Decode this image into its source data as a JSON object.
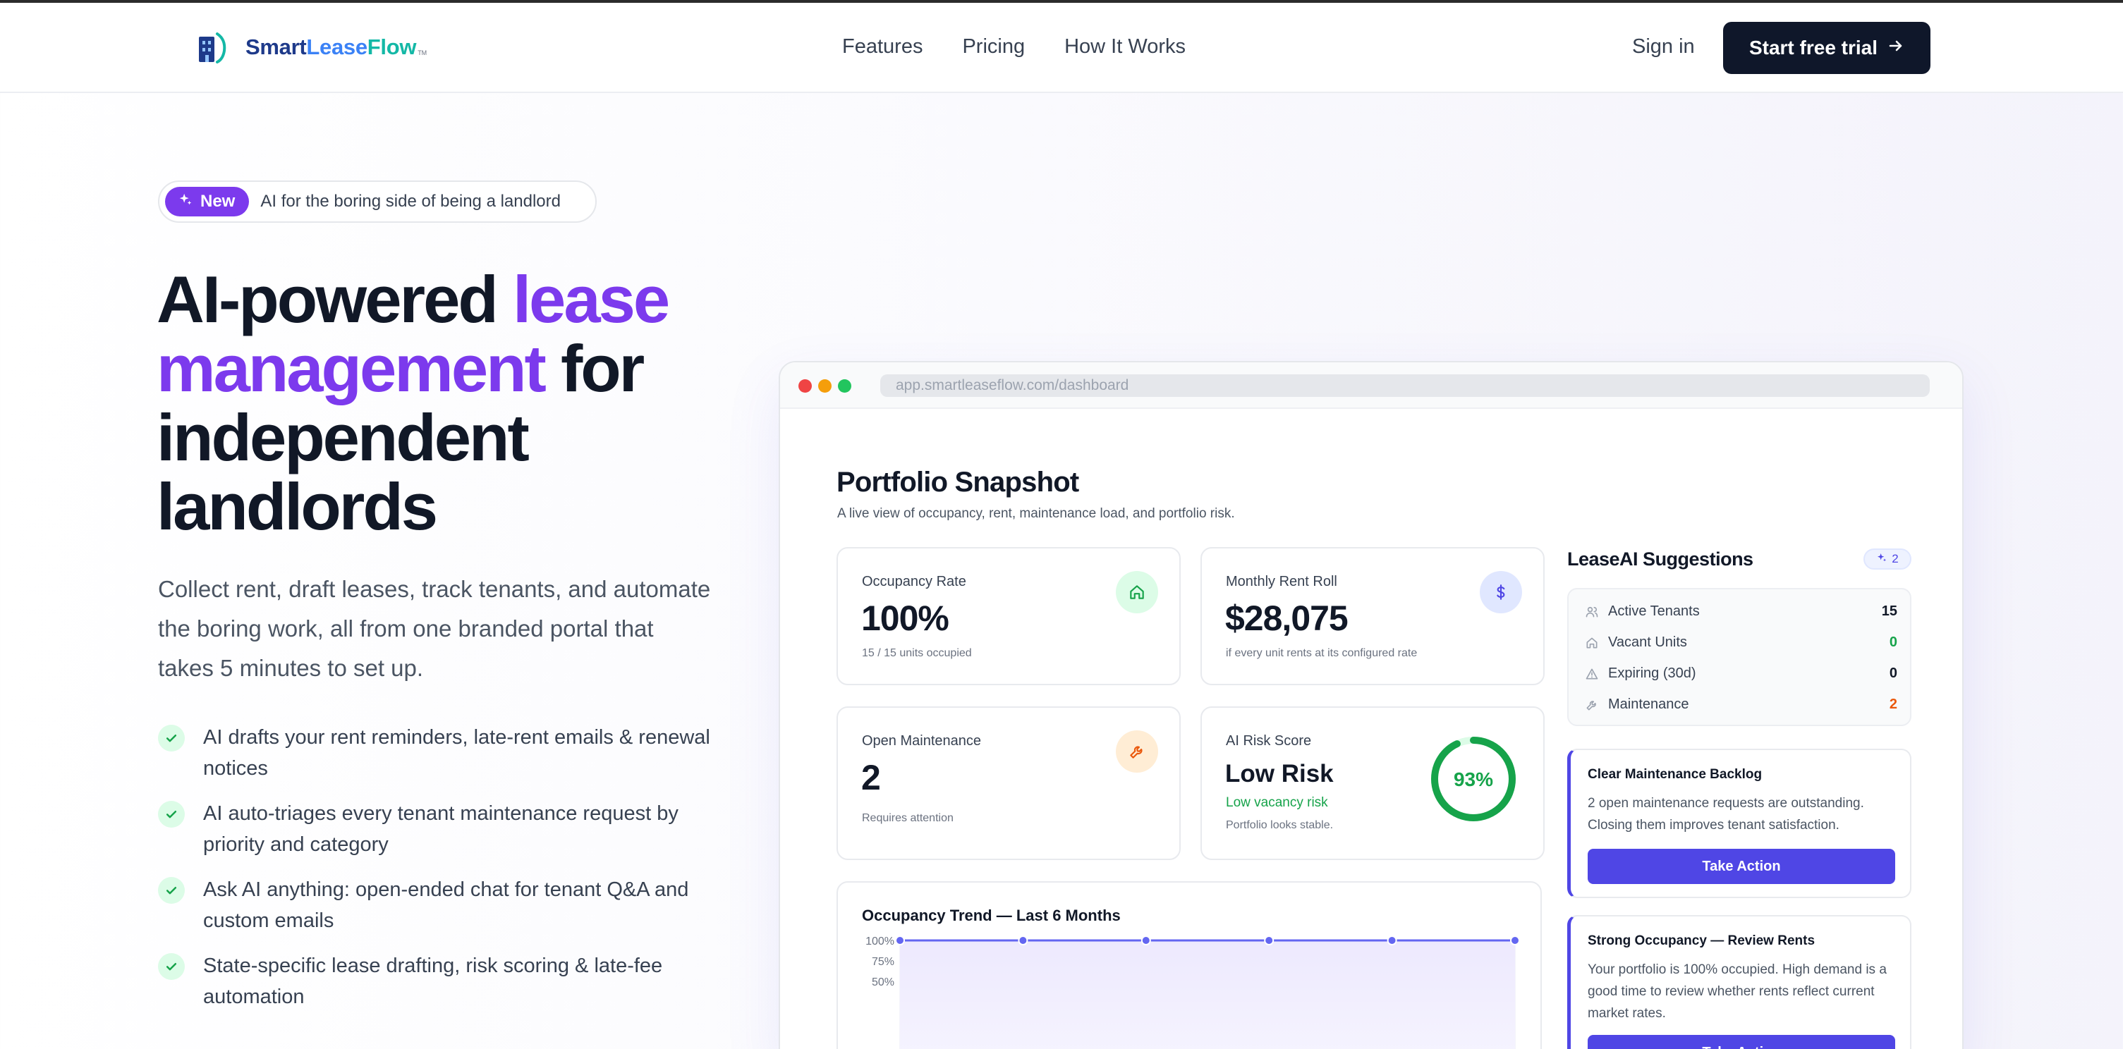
{
  "brand": {
    "part1": "Smart",
    "part2": "Lease",
    "part3": "Flow",
    "tm": "TM"
  },
  "nav": {
    "links": [
      "Features",
      "Pricing",
      "How It Works"
    ],
    "signin": "Sign in",
    "cta": "Start free trial"
  },
  "hero": {
    "badge": "New",
    "pill_text": "AI for the boring side of being a landlord",
    "title_part1": "AI-powered ",
    "title_highlight": "lease management",
    "title_part2": " for independent landlords",
    "subtitle": "Collect rent, draft leases, track tenants, and automate the boring work, all from one branded portal that takes 5 minutes to set up.",
    "features": [
      "AI drafts your rent reminders, late-rent emails & renewal notices",
      "AI auto-triages every tenant maintenance request by priority and category",
      "Ask AI anything: open-ended chat for tenant Q&A and custom emails",
      "State-specific lease drafting, risk scoring & late-fee automation"
    ]
  },
  "browser": {
    "url": "app.smartleaseflow.com/dashboard"
  },
  "dashboard": {
    "title": "Portfolio Snapshot",
    "subtitle": "A live view of occupancy, rent, maintenance load, and portfolio risk.",
    "occupancy": {
      "label": "Occupancy Rate",
      "value": "100%",
      "note": "15 / 15 units occupied"
    },
    "rent": {
      "label": "Monthly Rent Roll",
      "value": "$28,075",
      "note": "if every unit rents at its configured rate"
    },
    "maintenance": {
      "label": "Open Maintenance",
      "value": "2",
      "note": "Requires attention"
    },
    "risk": {
      "label": "AI Risk Score",
      "value": "Low Risk",
      "tag": "Low vacancy risk",
      "note": "Portfolio looks stable.",
      "gauge_label": "93%",
      "gauge_value": 93
    }
  },
  "chart_data": {
    "type": "area",
    "title": "Occupancy Trend — Last 6 Months",
    "y_ticks": [
      "100%",
      "75%",
      "50%"
    ],
    "values": [
      100,
      100,
      100,
      100,
      100,
      100
    ],
    "ylim": [
      0,
      100
    ],
    "grid": true
  },
  "sidebar": {
    "title": "LeaseAI Suggestions",
    "badge_count": "2",
    "stats": [
      {
        "label": "Active Tenants",
        "value": "15"
      },
      {
        "label": "Vacant Units",
        "value": "0"
      },
      {
        "label": "Expiring (30d)",
        "value": "0"
      },
      {
        "label": "Maintenance",
        "value": "2"
      }
    ],
    "suggestions": [
      {
        "title": "Clear Maintenance Backlog",
        "body": "2 open maintenance requests are outstanding. Closing them improves tenant satisfaction.",
        "button": "Take Action"
      },
      {
        "title": "Strong Occupancy — Review Rents",
        "body": "Your portfolio is 100% occupied. High demand is a good time to review whether rents reflect current market rates.",
        "button": "Take Action"
      }
    ]
  },
  "colors": {
    "accent_purple": "#7c3aed",
    "indigo": "#4f46e5",
    "navy": "#0f172a",
    "green": "#16a34a",
    "orange": "#ea580c"
  },
  "icons": {
    "logo": "building-logo-icon",
    "badge": "sparkle-icon",
    "cta": "arrow-right-icon",
    "check": "check-icon",
    "occupancy": "home-icon",
    "rent": "dollar-icon",
    "maintenance": "wrench-icon",
    "tenants": "users-icon",
    "vacant": "home-icon",
    "expiring": "warning-icon",
    "maint_stat": "wrench-icon"
  }
}
